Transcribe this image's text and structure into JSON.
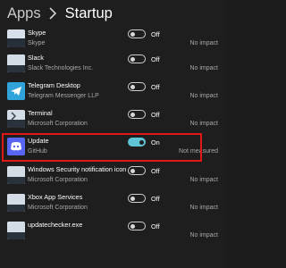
{
  "header": {
    "parent": "Apps",
    "current": "Startup"
  },
  "apps": [
    {
      "name": "Skype",
      "publisher": "Skype",
      "state": "Off",
      "impact": "No impact",
      "on": false,
      "icon": "skype-icon",
      "icon_color": "#d8e0ea"
    },
    {
      "name": "Slack",
      "publisher": "Slack Technologies Inc.",
      "state": "Off",
      "impact": "No impact",
      "on": false,
      "icon": "slack-icon",
      "icon_color": "#d4dde6"
    },
    {
      "name": "Telegram Desktop",
      "publisher": "Telegram Messenger LLP",
      "state": "Off",
      "impact": "No impact",
      "on": false,
      "icon": "telegram-icon",
      "icon_color": "#2fa3da"
    },
    {
      "name": "Terminal",
      "publisher": "Microsoft Corporation",
      "state": "Off",
      "impact": "No impact",
      "on": false,
      "icon": "terminal-icon",
      "icon_color": "#d4dde6"
    },
    {
      "name": "Update",
      "publisher": "GitHub",
      "state": "On",
      "impact": "Not measured",
      "on": true,
      "icon": "discord-icon",
      "icon_color": "#5865f2"
    },
    {
      "name": "Windows Security notification icon",
      "publisher": "Microsoft Corporation",
      "state": "Off",
      "impact": "No impact",
      "on": false,
      "icon": "shield-icon",
      "icon_color": "#d4dde6"
    },
    {
      "name": "Xbox App Services",
      "publisher": "Microsoft Corporation",
      "state": "Off",
      "impact": "No impact",
      "on": false,
      "icon": "xbox-icon",
      "icon_color": "#d4dde6"
    },
    {
      "name": "updatechecker.exe",
      "publisher": "",
      "state": "Off",
      "impact": "No impact",
      "on": false,
      "icon": "app-icon",
      "icon_color": "#d4dde6"
    }
  ],
  "colors": {
    "background": "#1e1e1e",
    "toggle_on": "#5ec4d6",
    "highlight": "#e01818"
  }
}
